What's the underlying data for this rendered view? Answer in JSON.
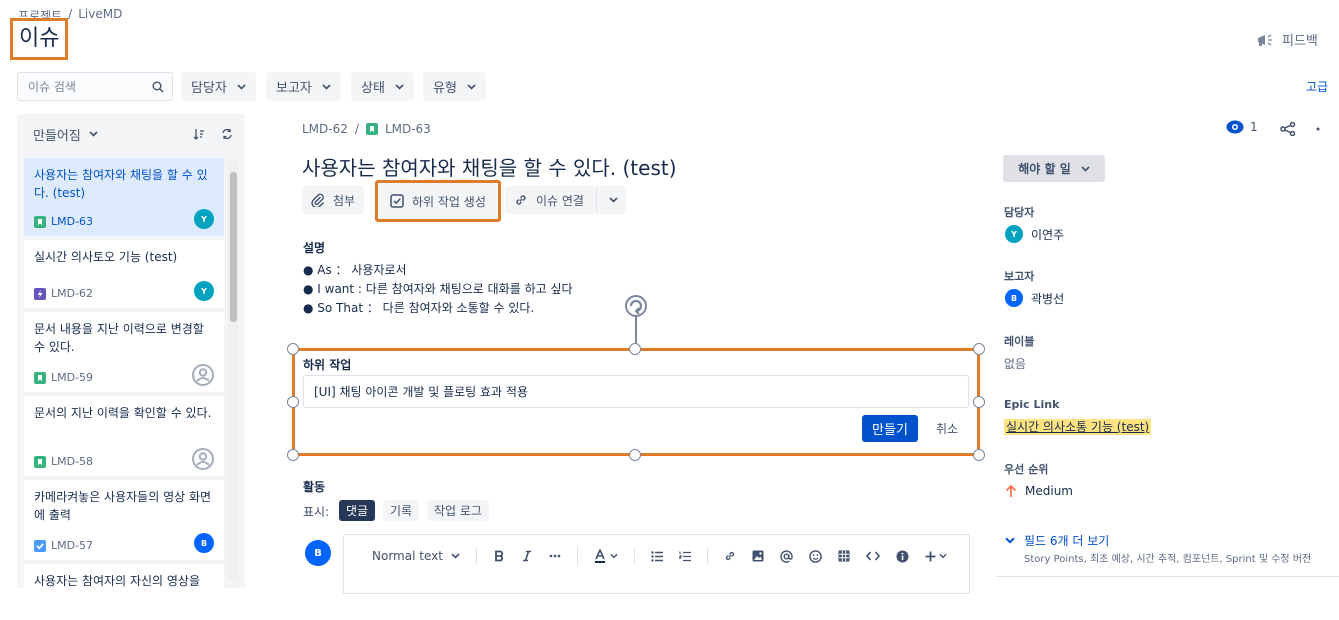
{
  "breadcrumb": {
    "projects": "프로젝트",
    "separator": "/",
    "project": "LiveMD"
  },
  "page_title": "이슈",
  "feedback_label": "피드백",
  "search": {
    "placeholder": "이슈 검색"
  },
  "filters": {
    "assignee": "담당자",
    "reporter": "보고자",
    "status": "상태",
    "type": "유형"
  },
  "advanced_label": "고급",
  "list": {
    "sort_label": "만들어짐",
    "items": [
      {
        "title": "사용자는 참여자와 채팅을 할 수 있다. (test)",
        "key": "LMD-63",
        "avatar": "Y"
      },
      {
        "title": "실시간 의사토오 기능 (test)",
        "key": "LMD-62",
        "avatar": "Y"
      },
      {
        "title": "문서 내용을 지난 이력으로 변경할 수 있다.",
        "key": "LMD-59"
      },
      {
        "title": "문서의 지난 이력을 확인할 수 있다.",
        "key": "LMD-58"
      },
      {
        "title": "카메라켜놓은 사용자들의 영상 화면에 출력",
        "key": "LMD-57",
        "avatar": "B"
      },
      {
        "title": "사용자는 참여자의 자신의 영상을"
      }
    ]
  },
  "detail": {
    "parent_key": "LMD-62",
    "separator": "/",
    "key": "LMD-63",
    "watchers": "1",
    "title": "사용자는 참여자와 채팅을 할 수 있다. (test)",
    "toolbar": {
      "attach": "첨부",
      "create_subtask": "하위 작업 생성",
      "link_issue": "이슈 연결"
    },
    "description_label": "설명",
    "description": [
      "● As ： 사용자로서",
      "● I want : 다른 참여자와 채팅으로 대화를 하고 싶다",
      "● So That ： 다른 참여자와 소통할 수 있다."
    ],
    "subtask_label": "하위 작업",
    "subtask_input": "[UI] 채팅 아이콘 개발 및 플로팅 효과 적용",
    "create_label": "만들기",
    "cancel_label": "취소",
    "activity_label": "활동",
    "show_label": "표시:",
    "activity_tabs": [
      "댓글",
      "기록",
      "작업 로그"
    ],
    "commenter_avatar": "B",
    "editor_text_style": "Normal text"
  },
  "sidebar": {
    "status": "해야 할 일",
    "assignee_label": "담당자",
    "assignee_avatar": "Y",
    "assignee": "이연주",
    "reporter_label": "보고자",
    "reporter_avatar": "B",
    "reporter": "곽병선",
    "labels_label": "레이블",
    "labels_value": "없음",
    "epic_label": "Epic Link",
    "epic_value": "실시간 의사소통 기능 (test)",
    "priority_label": "우선 순위",
    "priority_value": "Medium",
    "more_fields_label": "필드 6개 더 보기",
    "more_fields_desc": "Story Points, 최초 예상, 시간 추적, 컴포넌트, Sprint 및 수정 버전"
  },
  "colors": {
    "accent": "#0052cc",
    "highlight": "#e07b2a",
    "avatar_teal": "#00a3bf",
    "avatar_blue": "#0065ff",
    "story_green": "#36b37e",
    "epic_purple": "#6554c0",
    "task_blue": "#4c9aff",
    "epic_yellow": "#ffe380"
  }
}
